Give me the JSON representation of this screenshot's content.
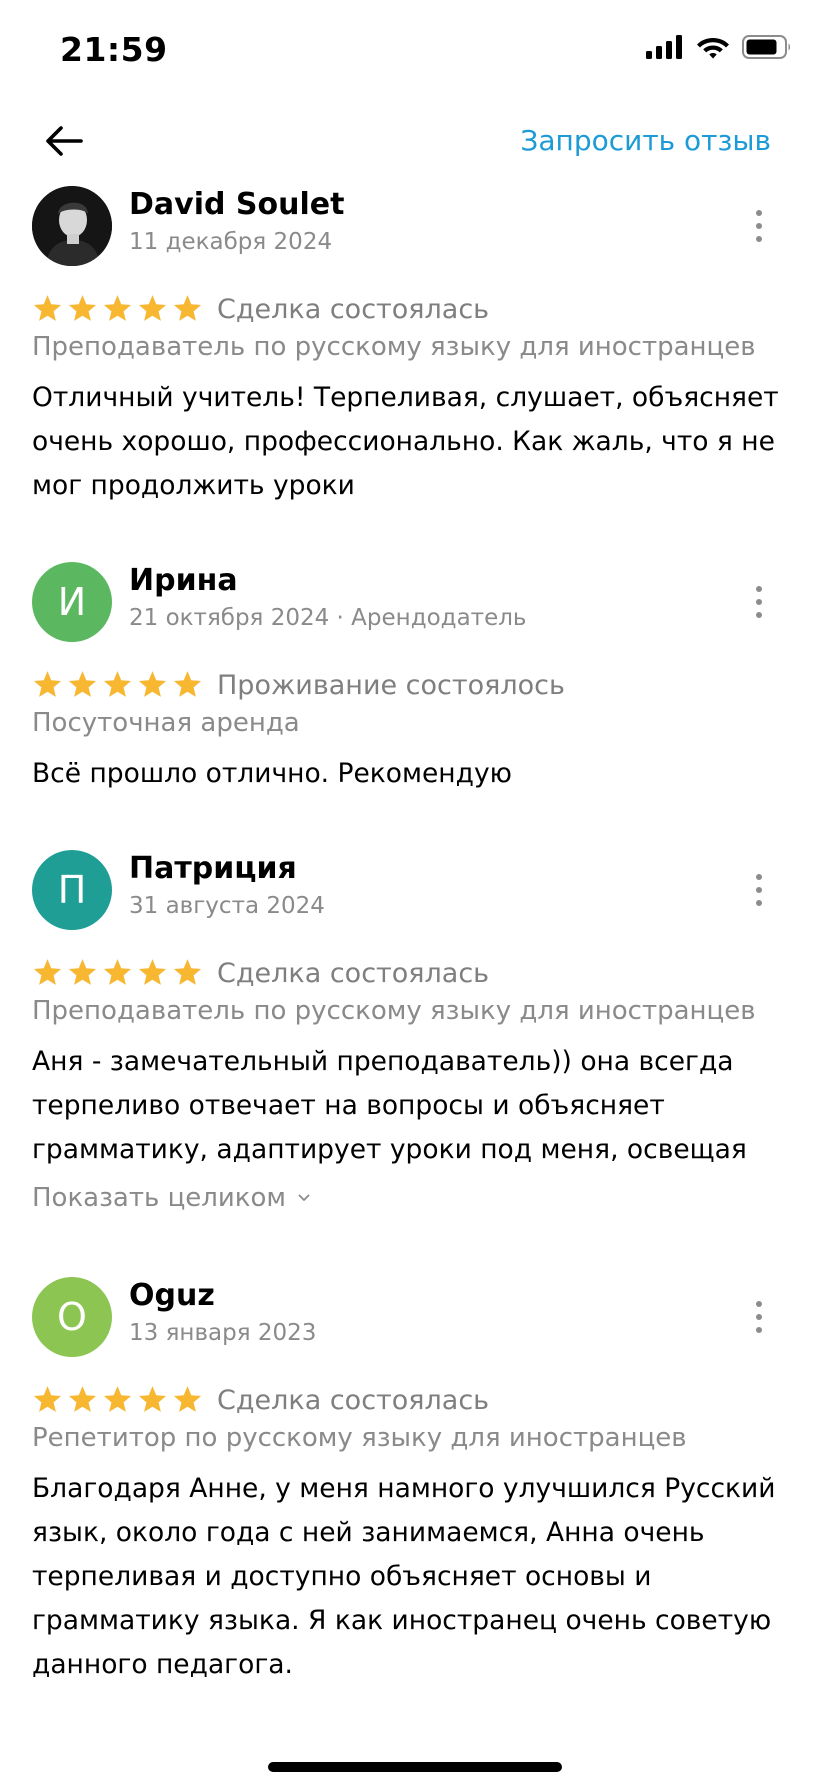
{
  "status_bar": {
    "time": "21:59"
  },
  "nav": {
    "back_icon": "arrow-left-icon",
    "request_review_label": "Запросить отзыв",
    "accent_color": "#1d9bd6"
  },
  "reviews": [
    {
      "name": "David Soulet",
      "date": "11 декабря 2024",
      "avatar_type": "photo",
      "rating": 5,
      "deal_status": "Сделка состоялась",
      "category": "Преподаватель по русскому языку для иностранцев",
      "text": "Отличный учитель! Терпеливая, слушает, объясняет очень хорошо, профессионально. Как жаль, что я не мог продолжить уроки"
    },
    {
      "name": "Ирина",
      "date": "21 октября 2024 · Арендодатель",
      "avatar_letter": "И",
      "avatar_color": "#5cb860",
      "rating": 5,
      "deal_status": "Проживание состоялось",
      "category": "Посуточная аренда",
      "text": "Всё прошло отлично. Рекомендую"
    },
    {
      "name": "Патриция",
      "date": "31 августа 2024",
      "avatar_letter": "П",
      "avatar_color": "#1e9e94",
      "rating": 5,
      "deal_status": "Сделка состоялась",
      "category": "Преподаватель по русскому языку для иностранцев",
      "text": "Аня - замечательный преподаватель)) она всегда терпеливо отвечает на вопросы и объясняет грамматику, адаптирует уроки под меня, освещая",
      "show_more_label": "Показать целиком"
    },
    {
      "name": "Oguz",
      "date": "13 января 2023",
      "avatar_letter": "O",
      "avatar_color": "#8dc552",
      "rating": 5,
      "deal_status": "Сделка состоялась",
      "category": "Репетитор по русскому языку для иностранцев",
      "text": "Благодаря Анне, у меня намного улучшился Русский язык, около года с ней занимаемся, Анна очень терпеливая и доступно объясняет основы и грамматику языка. Я как иностранец очень советую данного педагога."
    }
  ],
  "star_color": "#f7b731"
}
